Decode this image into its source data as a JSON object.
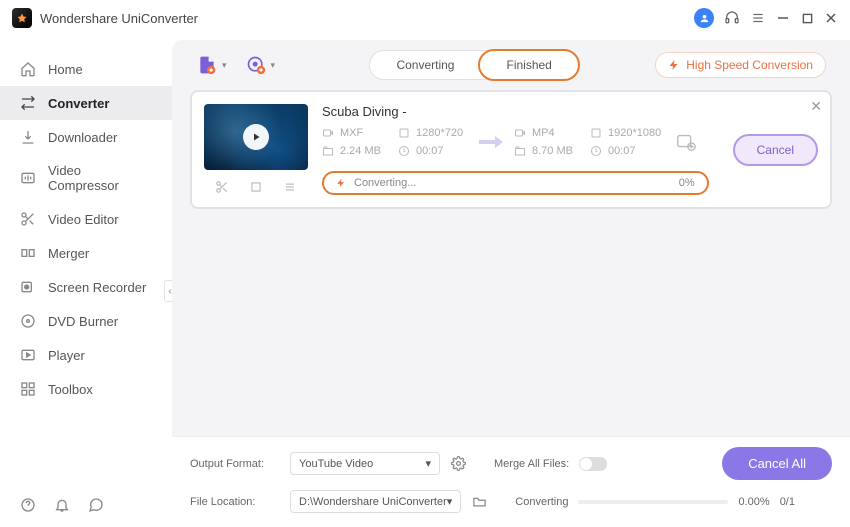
{
  "app": {
    "title": "Wondershare UniConverter"
  },
  "sidebar": {
    "items": [
      {
        "label": "Home"
      },
      {
        "label": "Converter"
      },
      {
        "label": "Downloader"
      },
      {
        "label": "Video Compressor"
      },
      {
        "label": "Video Editor"
      },
      {
        "label": "Merger"
      },
      {
        "label": "Screen Recorder"
      },
      {
        "label": "DVD Burner"
      },
      {
        "label": "Player"
      },
      {
        "label": "Toolbox"
      }
    ]
  },
  "toolbar": {
    "tabs": {
      "converting": "Converting",
      "finished": "Finished"
    },
    "high_speed": "High Speed Conversion"
  },
  "task": {
    "title": "Scuba Diving -",
    "source": {
      "format": "MXF",
      "resolution": "1280*720",
      "size": "2.24 MB",
      "duration": "00:07"
    },
    "target": {
      "format": "MP4",
      "resolution": "1920*1080",
      "size": "8.70 MB",
      "duration": "00:07"
    },
    "progress": {
      "status": "Converting...",
      "percent": "0%"
    },
    "cancel": "Cancel"
  },
  "bottom": {
    "output_format_label": "Output Format:",
    "output_format_value": "YouTube Video",
    "merge_label": "Merge All Files:",
    "file_location_label": "File Location:",
    "file_location_value": "D:\\Wondershare UniConverter",
    "converting_label": "Converting",
    "converting_pct": "0.00%",
    "converting_count": "0/1",
    "cancel_all": "Cancel All"
  }
}
